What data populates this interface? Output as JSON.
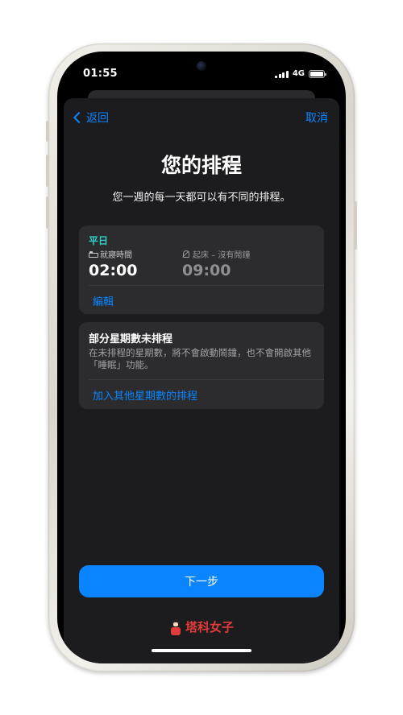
{
  "status": {
    "time": "01:55",
    "network": "4G"
  },
  "nav": {
    "back_label": "返回",
    "cancel_label": "取消"
  },
  "header": {
    "title": "您的排程",
    "subtitle": "您一週的每一天都可以有不同的排程。"
  },
  "schedule_card": {
    "day_label": "平日",
    "bedtime": {
      "label": "就寢時間",
      "time": "02:00"
    },
    "wake": {
      "label": "起床 – 沒有鬧鐘",
      "time": "09:00"
    },
    "edit_label": "編輯"
  },
  "unscheduled_card": {
    "title": "部分星期數未排程",
    "body": "在未排程的星期數，將不會啟動鬧鐘，也不會開啟其他「睡眠」功能。",
    "add_label": "加入其他星期數的排程"
  },
  "next_button_label": "下一步",
  "watermark": "塔科女子",
  "colors": {
    "accent": "#0a84ff",
    "weekday": "#30d0c8",
    "brand": "#e23b3b"
  }
}
